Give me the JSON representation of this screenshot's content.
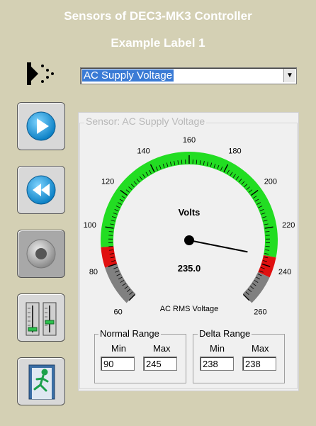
{
  "header": {
    "title": "Sensors of DEC3-MK3 Controller",
    "subtitle": "Example Label 1"
  },
  "sensor_select": {
    "value": "AC Supply Voltage",
    "icon": "sensor-dots-icon"
  },
  "sidebar": [
    {
      "name": "play-button",
      "icon": "play-icon",
      "enabled": true
    },
    {
      "name": "rewind-button",
      "icon": "rewind-icon",
      "enabled": true
    },
    {
      "name": "record-button",
      "icon": "record-icon",
      "enabled": false
    },
    {
      "name": "mixer-button",
      "icon": "mixer-sliders-icon",
      "enabled": true
    },
    {
      "name": "exit-button",
      "icon": "exit-door-icon",
      "enabled": true
    }
  ],
  "panel": {
    "legend": "Sensor: AC Supply Voltage"
  },
  "gauge": {
    "label": "Volts",
    "value_text": "235.0",
    "value": 235.0,
    "unit_caption": "AC RMS Voltage",
    "min": 60,
    "max": 260,
    "ticks": [
      "60",
      "80",
      "100",
      "120",
      "140",
      "160",
      "180",
      "200",
      "220",
      "240",
      "260"
    ],
    "bands": [
      {
        "from": 60,
        "to": 80,
        "color": "#808080"
      },
      {
        "from": 80,
        "to": 90,
        "color": "#e01010"
      },
      {
        "from": 90,
        "to": 235,
        "color": "#22dd22"
      },
      {
        "from": 235,
        "to": 245,
        "color": "#e01010"
      },
      {
        "from": 245,
        "to": 260,
        "color": "#808080"
      }
    ]
  },
  "normal_range": {
    "legend": "Normal Range",
    "min_label": "Min",
    "max_label": "Max",
    "min": "90",
    "max": "245"
  },
  "delta_range": {
    "legend": "Delta Range",
    "min_label": "Min",
    "max_label": "Max",
    "min": "238",
    "max": "238"
  }
}
